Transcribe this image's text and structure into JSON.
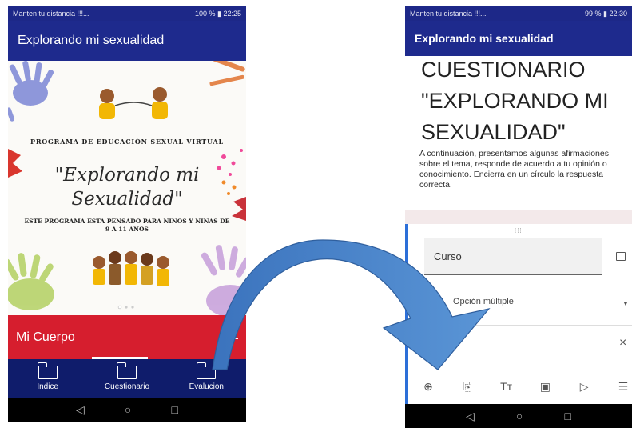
{
  "phone1": {
    "status_bar": {
      "left": "Manten tu distancia !!!...",
      "right": "100 % ▮ 22:25"
    },
    "app_title": "Explorando mi sexualidad",
    "banner": {
      "line1": "PROGRAMA DE EDUCACIÓN SEXUAL VIRTUAL",
      "script_title_1": "\"Explorando mi",
      "script_title_2": "Sexualidad\"",
      "line3": "ESTE PROGRAMA ESTA PENSADO PARA NIÑOS Y NIÑAS DE 9 A 11 AÑOS"
    },
    "red_bar_label": "Mi Cuerpo",
    "bottom_nav": [
      {
        "label": "Indice",
        "icon": "folder-icon"
      },
      {
        "label": "Cuestionario",
        "icon": "folder-icon"
      },
      {
        "label": "Evalucion",
        "icon": "folder-icon"
      }
    ],
    "system_nav": {
      "back": "◁",
      "home": "○",
      "recent": "□"
    }
  },
  "phone2": {
    "status_bar": {
      "left": "Manten tu distancia !!!...",
      "right": "99 % ▮ 22:30"
    },
    "app_title": "Explorando mi sexualidad",
    "form_title": "CUESTIONARIO \"EXPLORANDO MI SEXUALIDAD\"",
    "form_description": "A continuación, presentamos algunas afirmaciones sobre el tema, responde de acuerdo a tu opinión o conocimiento. Encierra en un círculo la respuesta correcta.",
    "question_placeholder": "Curso",
    "question_type": "Opción múltiple",
    "close_glyph": "×",
    "toolbar_icons": [
      "add-circle-icon",
      "import-icon",
      "text-icon",
      "image-icon",
      "video-icon",
      "section-icon"
    ],
    "system_nav": {
      "back": "◁",
      "home": "○",
      "recent": "□"
    }
  },
  "colors": {
    "appbar": "#1e2a8d",
    "bottom_nav": "#0f1c6b",
    "red_bar": "#d61e2e",
    "arrow": "#3f7bc7",
    "card_accent": "#2c6fd8"
  }
}
